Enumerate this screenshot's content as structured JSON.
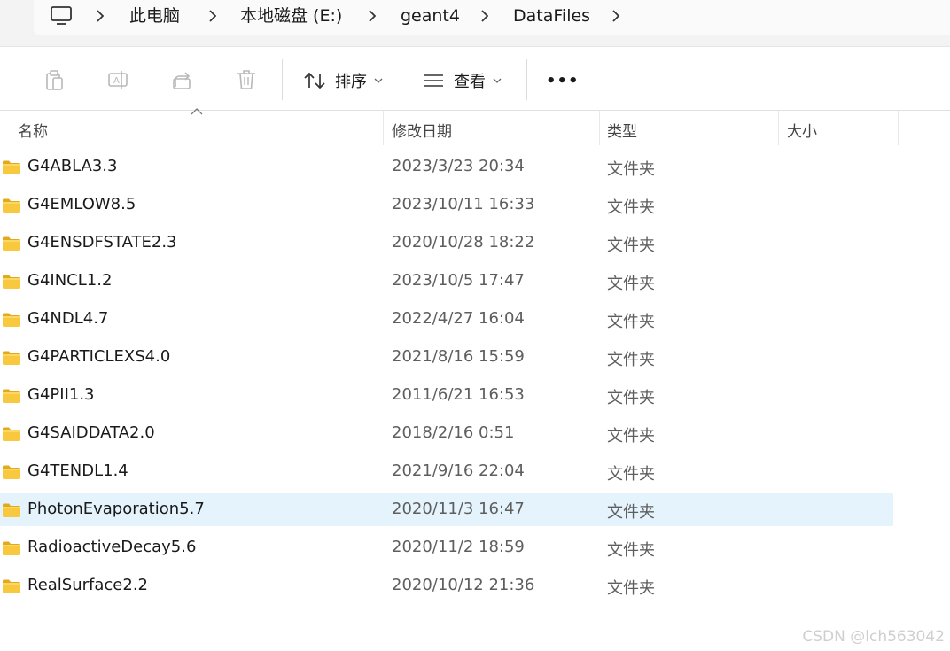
{
  "breadcrumb": {
    "items": [
      "此电脑",
      "本地磁盘 (E:)",
      "geant4",
      "DataFiles"
    ]
  },
  "toolbar": {
    "sort_label": "排序",
    "view_label": "查看",
    "more_label": "•••"
  },
  "columns": {
    "name": "名称",
    "modified": "修改日期",
    "type": "类型",
    "size": "大小"
  },
  "files": [
    {
      "name": "G4ABLA3.3",
      "modified": "2023/3/23 20:34",
      "type": "文件夹"
    },
    {
      "name": "G4EMLOW8.5",
      "modified": "2023/10/11 16:33",
      "type": "文件夹"
    },
    {
      "name": "G4ENSDFSTATE2.3",
      "modified": "2020/10/28 18:22",
      "type": "文件夹"
    },
    {
      "name": "G4INCL1.2",
      "modified": "2023/10/5 17:47",
      "type": "文件夹"
    },
    {
      "name": "G4NDL4.7",
      "modified": "2022/4/27 16:04",
      "type": "文件夹"
    },
    {
      "name": "G4PARTICLEXS4.0",
      "modified": "2021/8/16 15:59",
      "type": "文件夹"
    },
    {
      "name": "G4PII1.3",
      "modified": "2011/6/21 16:53",
      "type": "文件夹"
    },
    {
      "name": "G4SAIDDATA2.0",
      "modified": "2018/2/16 0:51",
      "type": "文件夹"
    },
    {
      "name": "G4TENDL1.4",
      "modified": "2021/9/16 22:04",
      "type": "文件夹"
    },
    {
      "name": "PhotonEvaporation5.7",
      "modified": "2020/11/3 16:47",
      "type": "文件夹",
      "selected": true
    },
    {
      "name": "RadioactiveDecay5.6",
      "modified": "2020/11/2 18:59",
      "type": "文件夹"
    },
    {
      "name": "RealSurface2.2",
      "modified": "2020/10/12 21:36",
      "type": "文件夹"
    }
  ],
  "watermark": "CSDN @lch563042",
  "colors": {
    "selected_row": "#e5f3fd",
    "folder_fill": "#f8c93f",
    "folder_tab": "#e3a91c"
  }
}
